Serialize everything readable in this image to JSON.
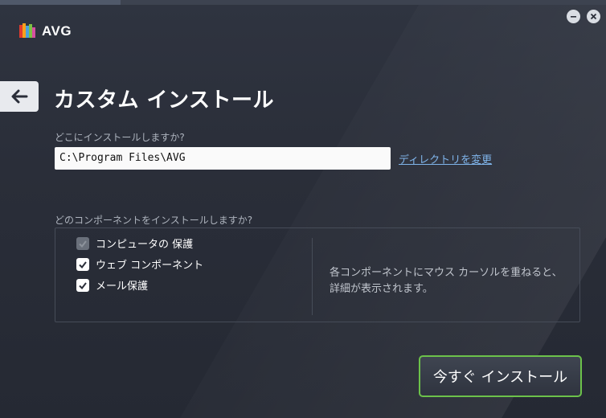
{
  "app": {
    "brand": "AVG"
  },
  "page": {
    "title": "カスタム インストール"
  },
  "location": {
    "question": "どこにインストールしますか?",
    "path_value": "C:\\Program Files\\AVG",
    "change_dir_link": "ディレクトリを変更"
  },
  "components": {
    "question": "どのコンポーネントをインストールしますか?",
    "items": [
      {
        "label": "コンピュータの 保護",
        "checked": true,
        "disabled": true
      },
      {
        "label": "ウェブ コンポーネント",
        "checked": true,
        "disabled": false
      },
      {
        "label": "メール保護",
        "checked": true,
        "disabled": false
      }
    ],
    "hint_line1": "各コンポーネントにマウス カーソルを重ねると、",
    "hint_line2": "詳細が表示されます。"
  },
  "actions": {
    "install_now": "今すぐ インストール"
  },
  "icons": {
    "logo": "avg-logo-icon",
    "minimize": "minimize-icon",
    "close": "close-icon",
    "back": "back-arrow-icon",
    "check": "checkmark-icon"
  },
  "colors": {
    "accent_green": "#6cc24a",
    "link_blue": "#7fb4ea",
    "background": "#2a2e39"
  }
}
